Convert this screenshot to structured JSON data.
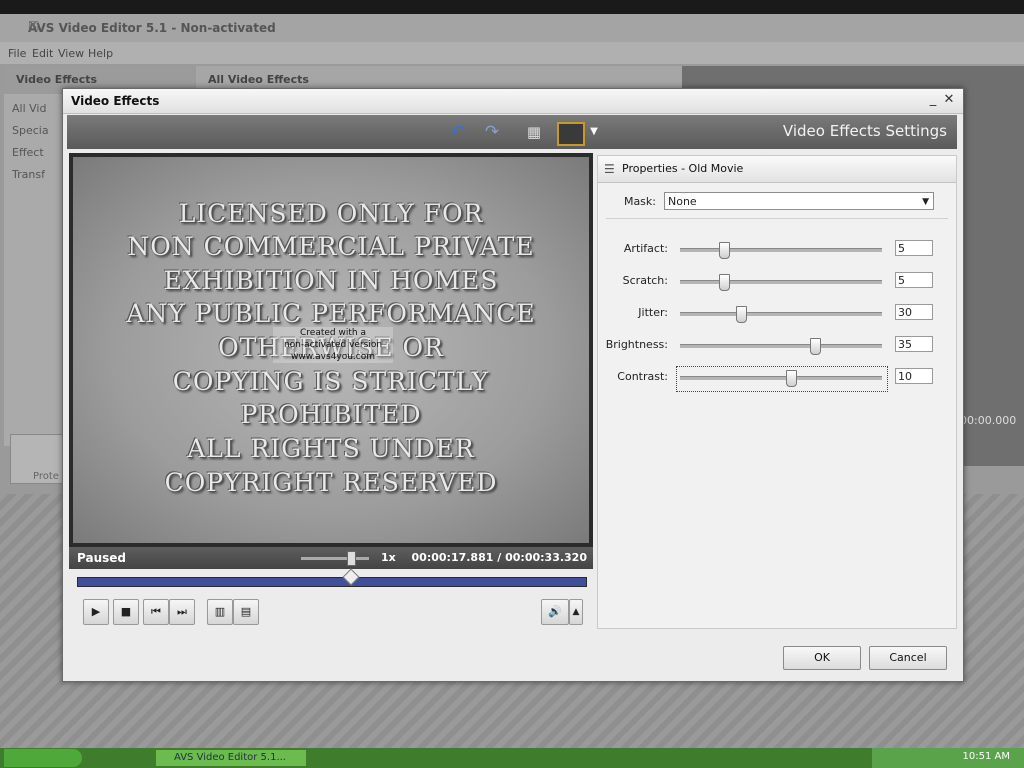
{
  "app": {
    "title": "AVS Video Editor 5.1 - Non-activated",
    "menu": [
      "File",
      "Edit",
      "View",
      "Help"
    ],
    "left_panel_title": "Video Effects",
    "left_panel_items": [
      "All Vid",
      "Specia",
      "Effect",
      "Transf"
    ],
    "center_panel_title": "All Video Effects",
    "timecode": "00:00.000",
    "protect_label": "Prote"
  },
  "dialog": {
    "title": "Video Effects",
    "settings_title": "Video Effects Settings",
    "toolbar": {
      "undo_icon": "undo-arrow",
      "redo_icon": "redo-arrow",
      "grid_icon": "grid",
      "monitor_icon": "monitor"
    },
    "preview": {
      "video_lines": [
        "LICENSED ONLY FOR",
        "NON COMMERCIAL PRIVATE",
        "EXHIBITION IN HOMES",
        "ANY PUBLIC PERFORMANCE",
        "OTHERWISE OR",
        "COPYING IS STRICTLY",
        "PROHIBITED",
        "ALL RIGHTS UNDER",
        "COPYRIGHT RESERVED"
      ],
      "watermark": [
        "Created with a",
        "non-activated version",
        "www.avs4you.com"
      ],
      "status": "Paused",
      "speed": "1x",
      "speed_fraction": 0.7,
      "current_time": "00:00:17.881",
      "separator": "/",
      "total_time": "00:00:33.320",
      "seek_fraction": 0.537
    },
    "properties": {
      "header": "Properties - Old Movie",
      "mask_label": "Mask:",
      "mask_value": "None",
      "sliders": [
        {
          "label": "Artifact:",
          "value": "5",
          "fraction": 0.22
        },
        {
          "label": "Scratch:",
          "value": "5",
          "fraction": 0.22
        },
        {
          "label": "Jitter:",
          "value": "30",
          "fraction": 0.3
        },
        {
          "label": "Brightness:",
          "value": "35",
          "fraction": 0.67
        },
        {
          "label": "Contrast:",
          "value": "10",
          "fraction": 0.55
        }
      ]
    },
    "ok_label": "OK",
    "cancel_label": "Cancel"
  },
  "taskbar": {
    "task_label": "AVS Video Editor 5.1...",
    "clock": "10:51 AM"
  },
  "colors": {
    "seek_bar": "#3f4f9a",
    "toolbar_dark": "#5a5a5a",
    "taskbar_green": "#3f7c2c"
  }
}
